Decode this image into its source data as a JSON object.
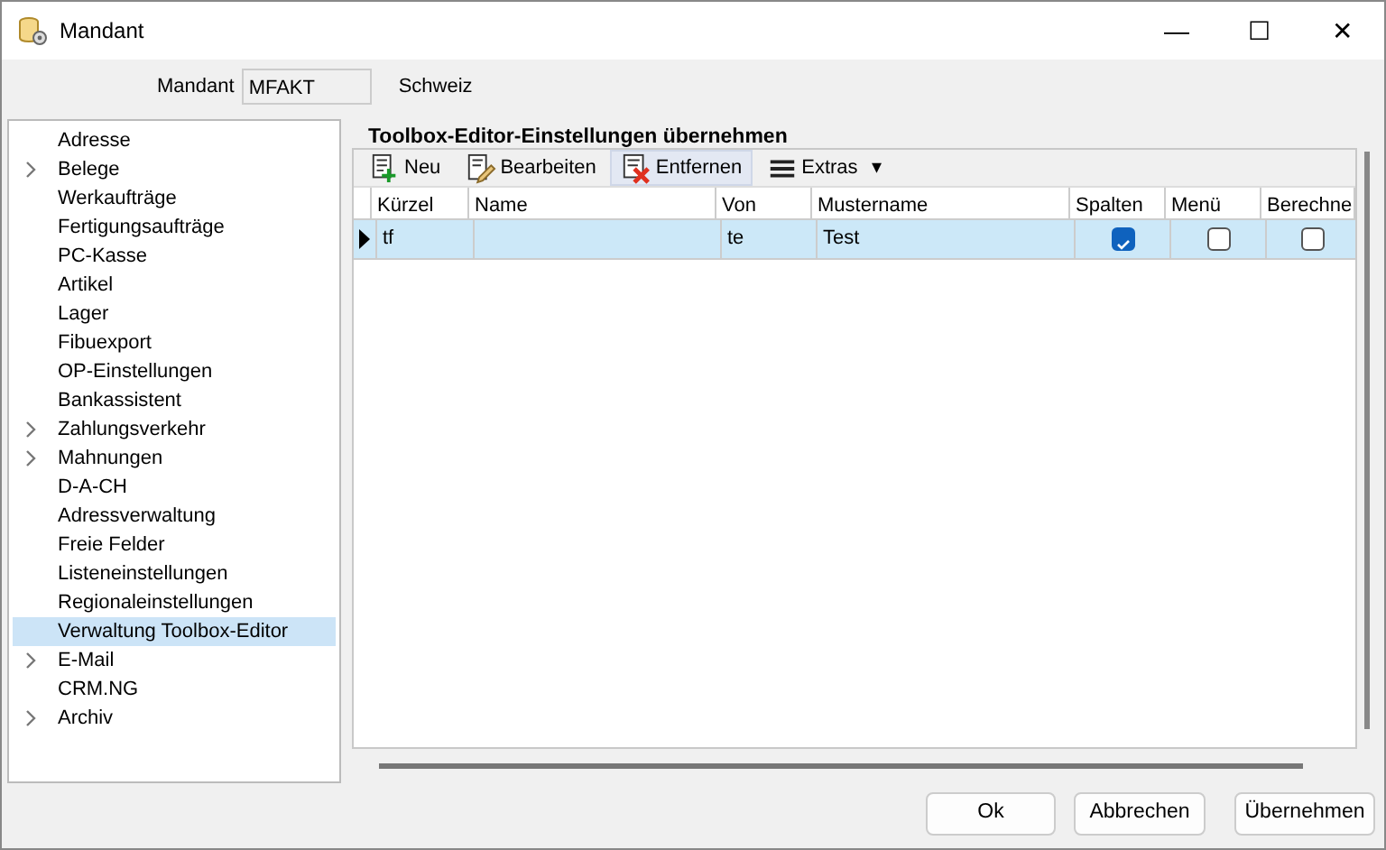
{
  "window": {
    "title": "Mandant",
    "controls": [
      "—",
      "☐",
      "✕"
    ]
  },
  "mandant": {
    "label": "Mandant",
    "value": "MFAKT",
    "name": "Schweiz"
  },
  "sidebar": {
    "items": [
      {
        "label": "Adresse",
        "has_children": false,
        "selected": false
      },
      {
        "label": "Belege",
        "has_children": true,
        "selected": false
      },
      {
        "label": "Werkaufträge",
        "has_children": false,
        "selected": false
      },
      {
        "label": "Fertigungsaufträge",
        "has_children": false,
        "selected": false
      },
      {
        "label": "PC-Kasse",
        "has_children": false,
        "selected": false
      },
      {
        "label": "Artikel",
        "has_children": false,
        "selected": false
      },
      {
        "label": "Lager",
        "has_children": false,
        "selected": false
      },
      {
        "label": "Fibuexport",
        "has_children": false,
        "selected": false
      },
      {
        "label": "OP-Einstellungen",
        "has_children": false,
        "selected": false
      },
      {
        "label": "Bankassistent",
        "has_children": false,
        "selected": false
      },
      {
        "label": "Zahlungsverkehr",
        "has_children": true,
        "selected": false
      },
      {
        "label": "Mahnungen",
        "has_children": true,
        "selected": false
      },
      {
        "label": "D-A-CH",
        "has_children": false,
        "selected": false
      },
      {
        "label": "Adressverwaltung",
        "has_children": false,
        "selected": false
      },
      {
        "label": "Freie Felder",
        "has_children": false,
        "selected": false
      },
      {
        "label": "Listeneinstellungen",
        "has_children": false,
        "selected": false
      },
      {
        "label": "Regionaleinstellungen",
        "has_children": false,
        "selected": false
      },
      {
        "label": "Verwaltung Toolbox-Editor",
        "has_children": false,
        "selected": true
      },
      {
        "label": "E-Mail",
        "has_children": true,
        "selected": false
      },
      {
        "label": "CRM.NG",
        "has_children": false,
        "selected": false
      },
      {
        "label": "Archiv",
        "has_children": true,
        "selected": false
      }
    ]
  },
  "group": {
    "title": "Toolbox-Editor-Einstellungen übernehmen"
  },
  "toolbar": [
    {
      "kind": "new",
      "label": "Neu",
      "hovered": false
    },
    {
      "kind": "edit",
      "label": "Bearbeiten",
      "hovered": false
    },
    {
      "kind": "delete",
      "label": "Entfernen",
      "hovered": true
    },
    {
      "kind": "menu",
      "label": "Extras",
      "hovered": false,
      "caret": "▾"
    }
  ],
  "table": {
    "columns": [
      {
        "label": "Kürzel",
        "kind": "text"
      },
      {
        "label": "Name",
        "kind": "text"
      },
      {
        "label": "Von",
        "kind": "text"
      },
      {
        "label": "Mustername",
        "kind": "text"
      },
      {
        "label": "Spalten",
        "kind": "check"
      },
      {
        "label": "Menü",
        "kind": "check"
      },
      {
        "label": "Berechne",
        "kind": "check"
      }
    ],
    "rows": [
      {
        "selected": true,
        "current": true,
        "cells": [
          "tf",
          "",
          "te",
          "Test",
          true,
          false,
          false
        ]
      }
    ]
  },
  "buttons": [
    {
      "label": "Ok"
    },
    {
      "label": "Abbrechen"
    },
    {
      "label": "Übernehmen"
    }
  ]
}
